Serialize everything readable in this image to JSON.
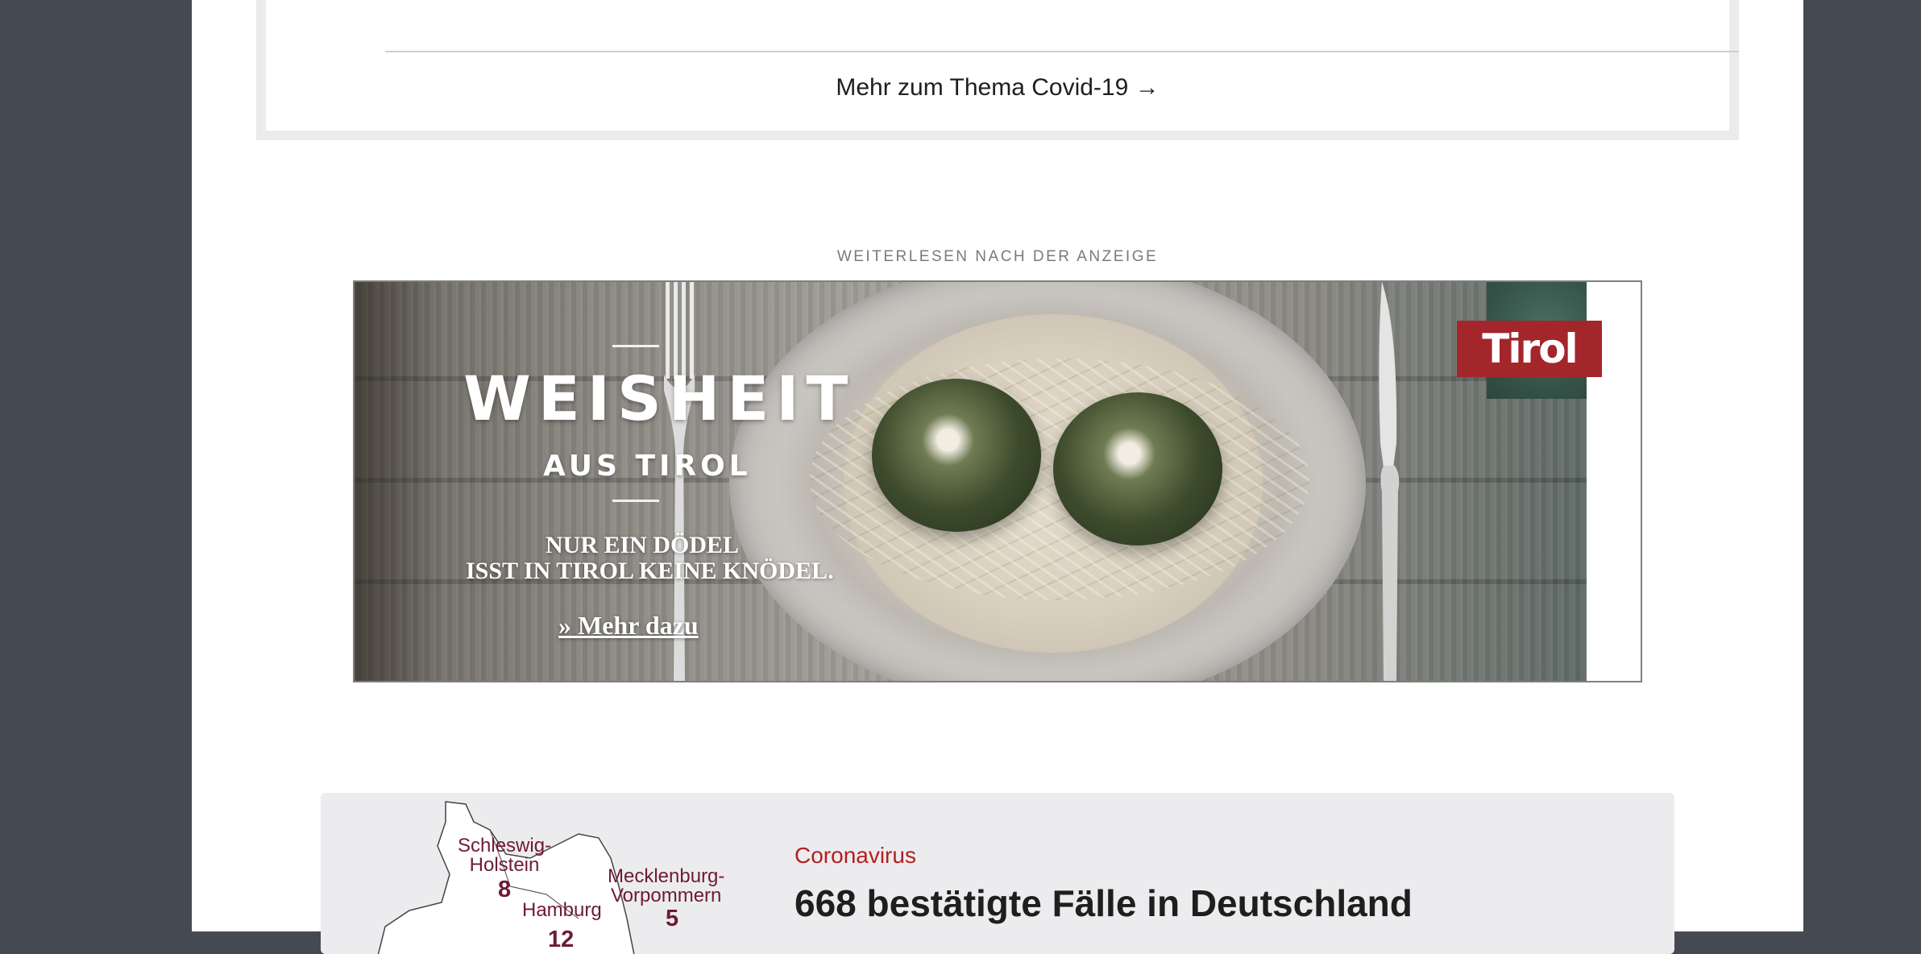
{
  "covid_box": {
    "link_text": "Mehr zum Thema Covid-19 →"
  },
  "ad": {
    "label": "WEITERLESEN NACH DER ANZEIGE",
    "headline": "WEISHEIT",
    "subheadline": "AUS TIROL",
    "line1": "NUR EIN DÖDEL",
    "line2": "ISST IN TIROL KEINE KNÖDEL.",
    "cta": "» Mehr dazu",
    "logo_text": "Tirol",
    "logo_color": "#a3262b"
  },
  "teaser": {
    "kicker": "Coronavirus",
    "title": "668 bestätigte Fälle in Deutschland",
    "kicker_color": "#b41e1e",
    "map": {
      "regions": [
        {
          "name": "Schleswig-\nHolstein",
          "count": "8"
        },
        {
          "name": "Mecklenburg-\nVorpommern",
          "count": "5"
        },
        {
          "name": "Hamburg",
          "count": "12"
        }
      ],
      "label_color": "#6e1b35"
    }
  }
}
